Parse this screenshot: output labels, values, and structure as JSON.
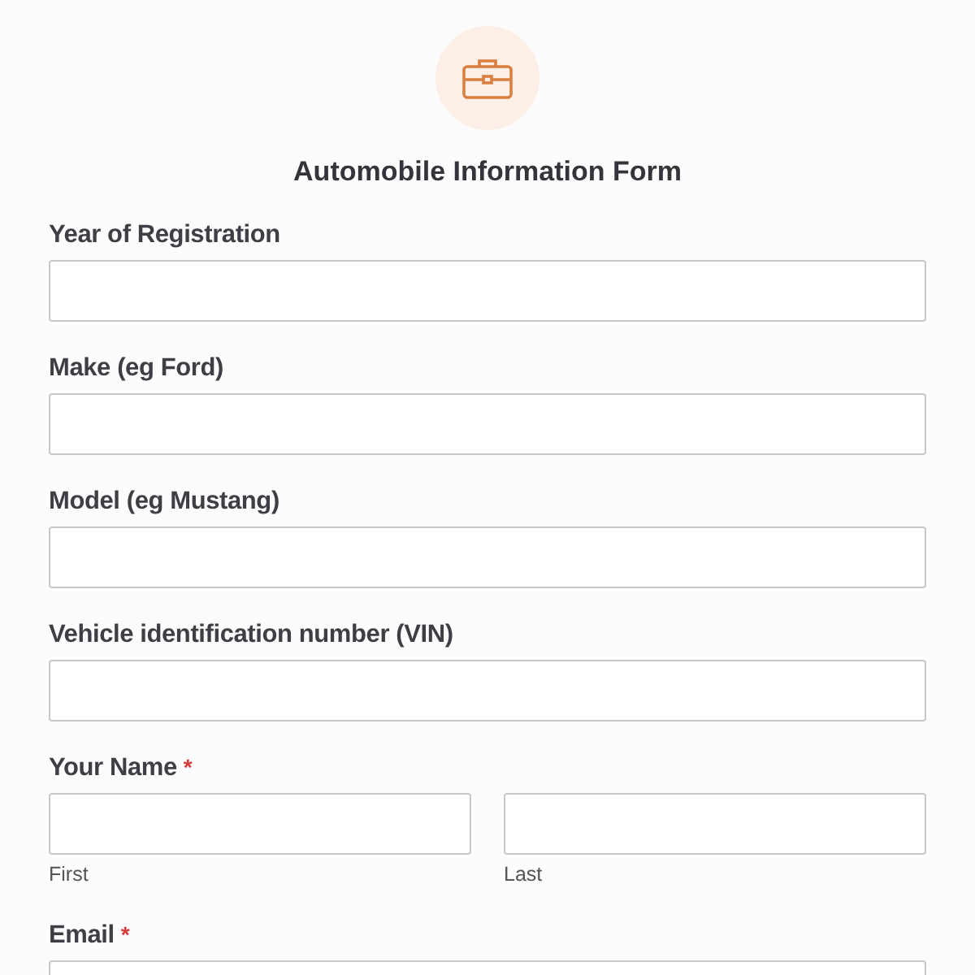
{
  "form": {
    "title": "Automobile Information Form",
    "fields": [
      {
        "kind": "text",
        "label": "Year of Registration"
      },
      {
        "kind": "text",
        "label": "Make (eg Ford)"
      },
      {
        "kind": "text",
        "label": "Model (eg Mustang)"
      },
      {
        "kind": "text",
        "label": "Vehicle identification number (VIN)"
      },
      {
        "kind": "name",
        "label": "Your Name",
        "required_mark": "*",
        "parts": [
          {
            "sublabel": "First"
          },
          {
            "sublabel": "Last"
          }
        ]
      },
      {
        "kind": "text",
        "label": "Email",
        "required_mark": "*"
      }
    ]
  }
}
